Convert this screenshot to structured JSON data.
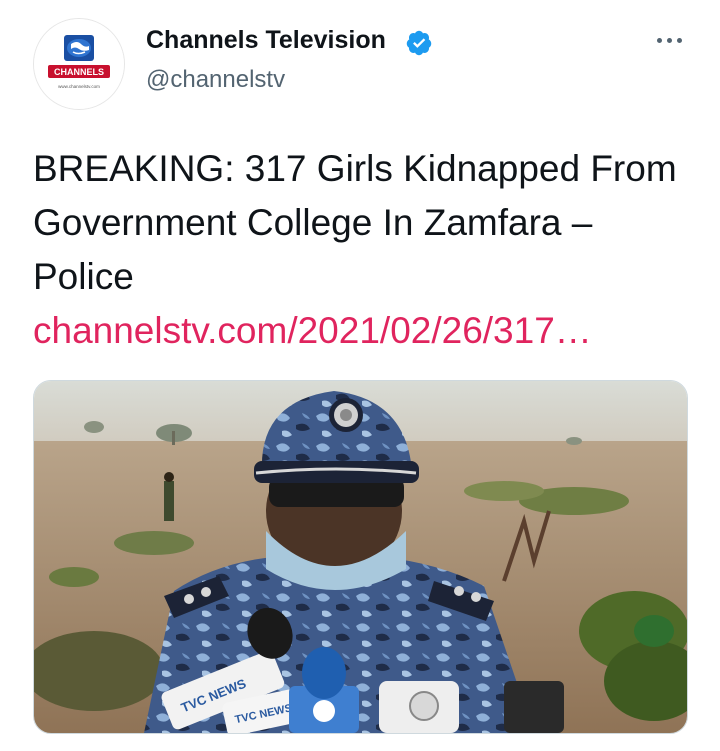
{
  "tweet": {
    "author": {
      "display_name": "Channels Television",
      "handle": "@channelstv",
      "verified": true,
      "avatar_logo_text": "CHANNELS",
      "avatar_url_text": "www.channelstv.com"
    },
    "text": "BREAKING: 317 Girls Kidnapped From Government College In Zamfara – Police",
    "link": "channelstv.com/2021/02/26/317…",
    "colors": {
      "link": "#e0245e",
      "verified": "#1d9bf0",
      "secondary": "#536471"
    },
    "icons": [
      "verified-badge-icon",
      "more-options-icon"
    ],
    "media": {
      "microphone_labels": [
        "TVC NEWS",
        "TVC NEWS"
      ]
    }
  }
}
